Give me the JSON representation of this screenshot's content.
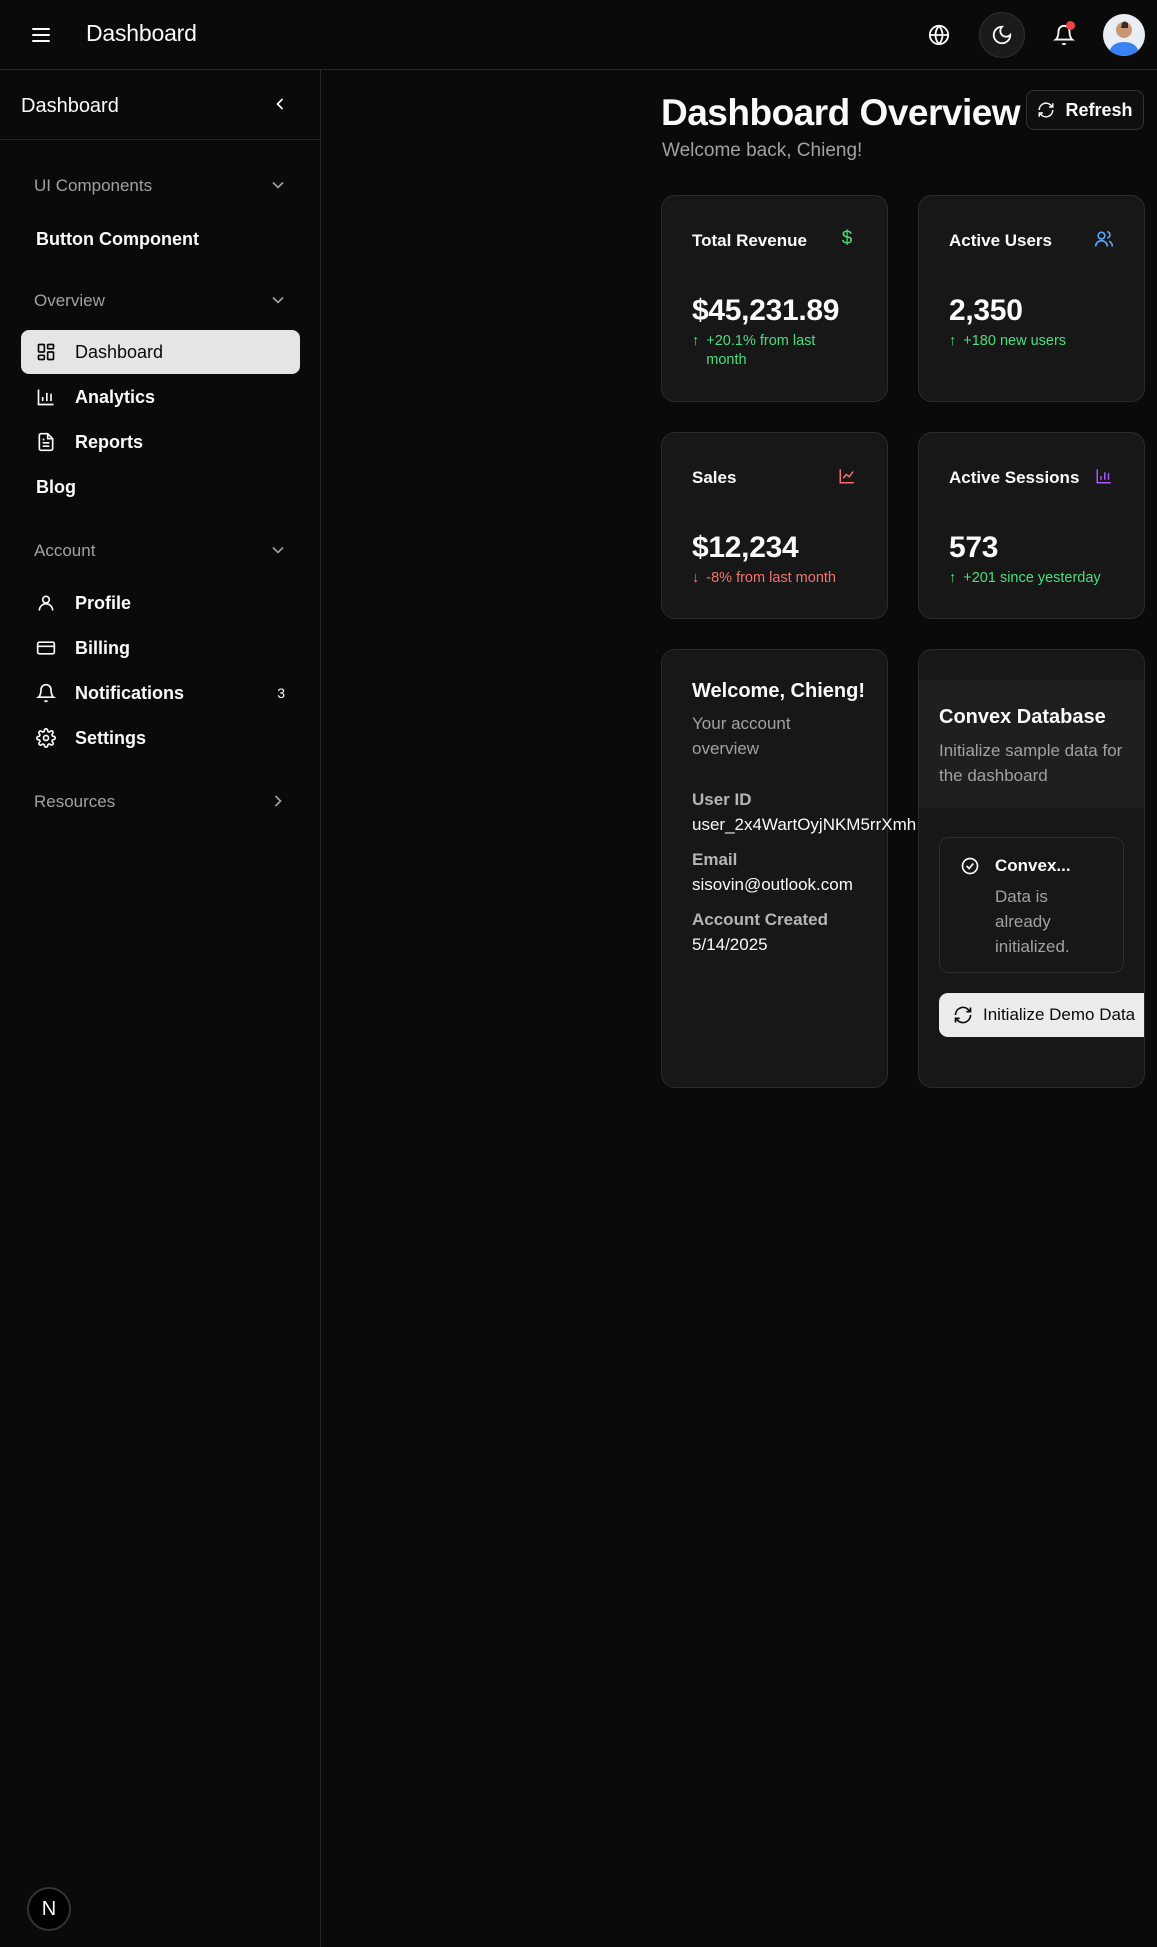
{
  "topbar": {
    "title": "Dashboard"
  },
  "sidebar": {
    "title": "Dashboard",
    "groups": [
      {
        "label": "UI Components"
      },
      {
        "label": "Overview"
      },
      {
        "label": "Account"
      },
      {
        "label": "Resources"
      }
    ],
    "items": [
      {
        "label": "Button Component"
      },
      {
        "label": "Dashboard"
      },
      {
        "label": "Analytics"
      },
      {
        "label": "Reports"
      },
      {
        "label": "Blog"
      },
      {
        "label": "Profile"
      },
      {
        "label": "Billing"
      },
      {
        "label": "Notifications",
        "badge": "3"
      },
      {
        "label": "Settings"
      }
    ],
    "footer_badge": "N"
  },
  "main": {
    "title": "Dashboard Overview",
    "subtitle": "Welcome back, Chieng!",
    "refresh_label": "Refresh",
    "stats": [
      {
        "title": "Total Revenue",
        "value": "$45,231.89",
        "change": "+20.1% from last month",
        "direction": "up",
        "icon": "dollar-icon",
        "color": "#4ade80"
      },
      {
        "title": "Active Users",
        "value": "2,350",
        "change": "+180 new users",
        "direction": "up",
        "icon": "users-icon",
        "color": "#60a5fa"
      },
      {
        "title": "Sales",
        "value": "$12,234",
        "change": "-8% from last month",
        "direction": "down",
        "icon": "trend-chart-icon",
        "color": "#f87171"
      },
      {
        "title": "Active Sessions",
        "value": "573",
        "change": "+201 since yesterday",
        "direction": "up",
        "icon": "bar-chart-icon",
        "color": "#a855f7"
      }
    ],
    "welcome": {
      "title": "Welcome, Chieng!",
      "subtitle": "Your account overview",
      "user_id_label": "User ID",
      "user_id": "user_2x4WartOyjNKM5rrXmh",
      "email_label": "Email",
      "email": "sisovin@outlook.com",
      "created_label": "Account Created",
      "created": "5/14/2025"
    },
    "database": {
      "title": "Convex Database",
      "subtitle": "Initialize sample data for the dashboard",
      "status_title": "Convex...",
      "status_message": "Data is already initialized.",
      "button_label": "Initialize Demo Data"
    }
  }
}
